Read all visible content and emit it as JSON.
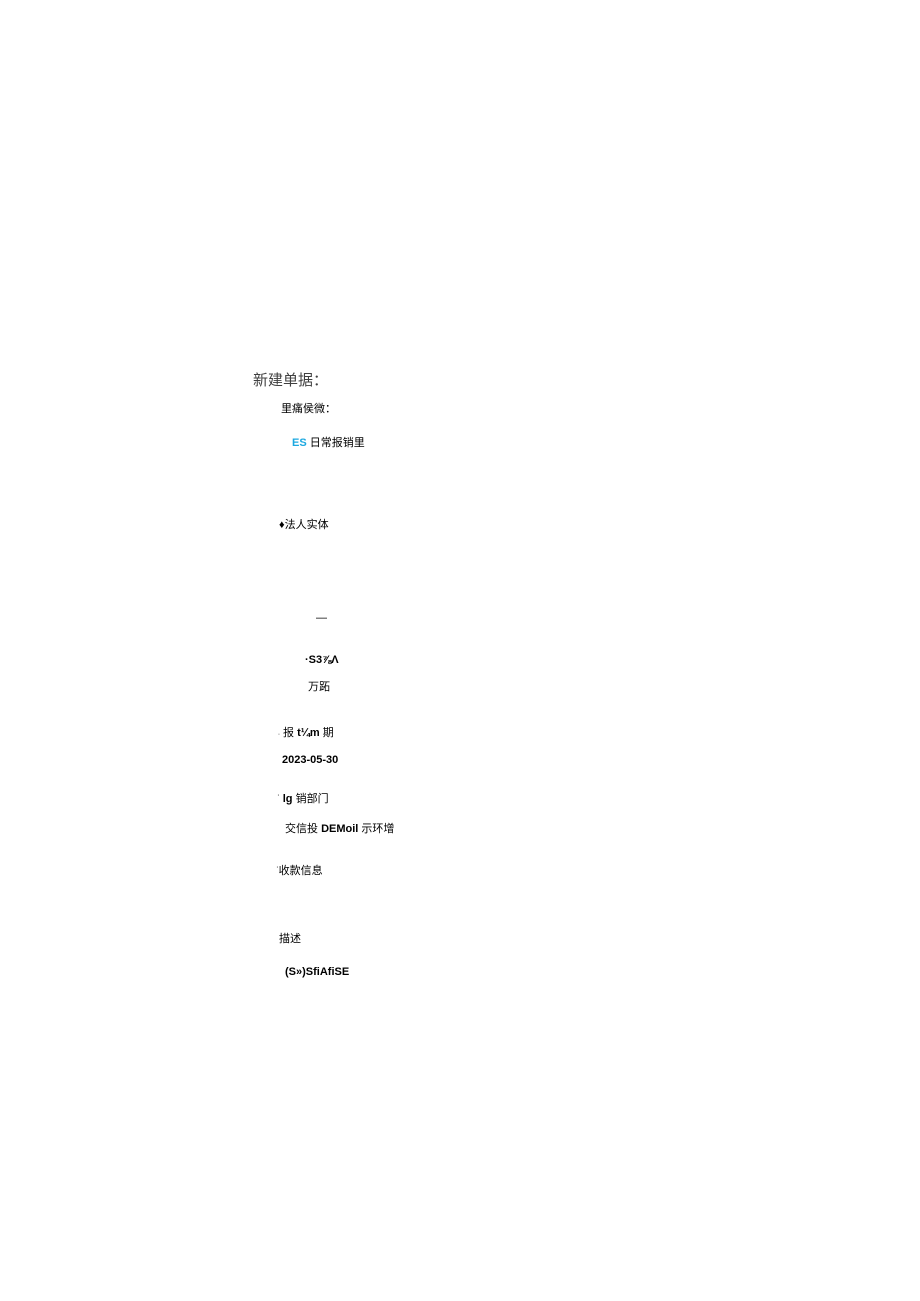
{
  "title": "新建单据：",
  "subtitle": "里痛侯微：",
  "es_tag": "ES",
  "es_text": "日常报销里",
  "legal_entity_label": "♦法人实体",
  "dash": "—",
  "s37a": "·S3⅞Λ",
  "wanshi": "万跖",
  "report_date": {
    "label_dot": ".",
    "label_prefix": "报",
    "label_bold": "t¼m",
    "label_suffix": "期",
    "value": "2023-05-30"
  },
  "sales_dept": {
    "label_dot": "·",
    "label_bold": "lg",
    "label_suffix": "销部门",
    "value_prefix": "交信投",
    "value_bold": "DEMoil",
    "value_suffix": "示环增"
  },
  "payment_info": {
    "dot": "·",
    "label": "收款信息"
  },
  "description": {
    "label": "描述",
    "value": "(S»)SfiAfiSE"
  }
}
